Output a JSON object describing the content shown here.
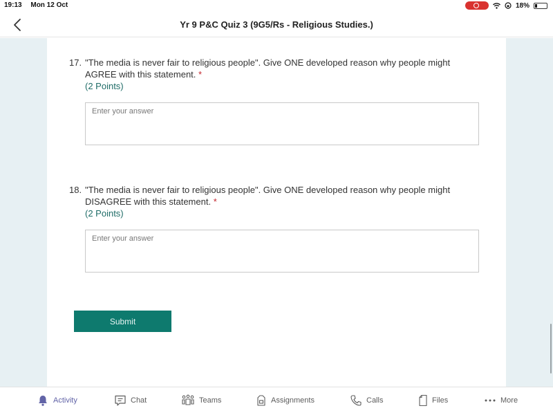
{
  "status_bar": {
    "time": "19:13",
    "date": "Mon 12 Oct",
    "battery_percent": "18%",
    "battery_level": 0.18,
    "recording_indicator": "screen-record-icon",
    "wifi_icon": "wifi-icon",
    "orientation_lock_icon": "orientation-lock-icon"
  },
  "nav": {
    "back_icon": "chevron-left-icon",
    "title": "Yr 9 P&C Quiz 3 (9G5/Rs - Religious Studies.)"
  },
  "questions": [
    {
      "number": "17.",
      "text": "\"The media is never fair to religious people\". Give ONE developed reason why people might AGREE with this statement.",
      "required_mark": "*",
      "points": "(2 Points)",
      "answer_placeholder": "Enter your answer",
      "answer_value": ""
    },
    {
      "number": "18.",
      "text": "\"The media is never fair to religious people\". Give ONE developed reason why people might DISAGREE with this statement.",
      "required_mark": "*",
      "points": "(2 Points)",
      "answer_placeholder": "Enter your answer",
      "answer_value": ""
    }
  ],
  "submit_label": "Submit",
  "colors": {
    "accent": "#0e7a6e",
    "points_text": "#1f6c67",
    "required": "#c4262e",
    "active_tab": "#6264a7",
    "page_background": "#e7f0f3"
  },
  "tab_bar": {
    "items": [
      {
        "label": "Activity",
        "icon": "bell-icon",
        "active": true
      },
      {
        "label": "Chat",
        "icon": "chat-icon",
        "active": false
      },
      {
        "label": "Teams",
        "icon": "teams-icon",
        "active": false
      },
      {
        "label": "Assignments",
        "icon": "assignments-icon",
        "active": false
      },
      {
        "label": "Calls",
        "icon": "phone-icon",
        "active": false
      },
      {
        "label": "Files",
        "icon": "file-icon",
        "active": false
      },
      {
        "label": "More",
        "icon": "more-icon",
        "active": false
      }
    ]
  }
}
